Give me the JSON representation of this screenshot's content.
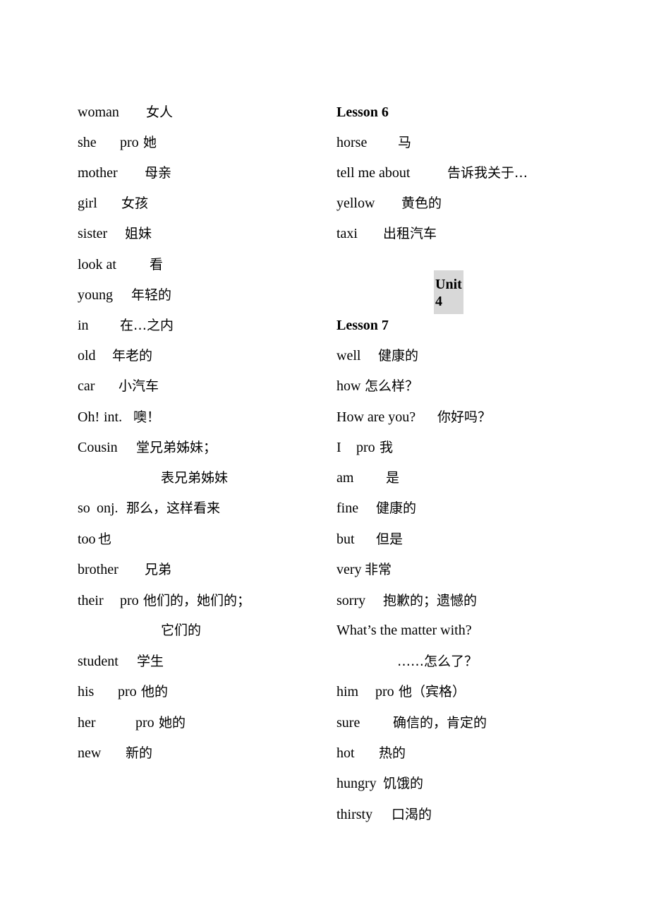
{
  "left_column": {
    "entries": [
      {
        "term": "woman",
        "meaning": "女人"
      },
      {
        "term": "she",
        "pos": "pro",
        "meaning": "她"
      },
      {
        "term": "mother",
        "meaning": "母亲"
      },
      {
        "term": "girl",
        "meaning": "女孩"
      },
      {
        "term": "sister",
        "meaning": "姐妹"
      },
      {
        "term": "look at",
        "meaning": "看"
      },
      {
        "term": "young",
        "meaning": "年轻的"
      },
      {
        "term": "in",
        "meaning": "在…之内"
      },
      {
        "term": "old",
        "meaning": "年老的"
      },
      {
        "term": "car",
        "meaning": "小汽车"
      },
      {
        "term": "Oh!",
        "pos": "int.",
        "meaning": "噢！"
      },
      {
        "term": "Cousin",
        "meaning": "堂兄弟姊妹；"
      },
      {
        "term": "",
        "meaning": "表兄弟姊妹"
      },
      {
        "term": "so",
        "pos": "onj.",
        "meaning": "那么，这样看来"
      },
      {
        "term": "too",
        "meaning": "也"
      },
      {
        "term": "brother",
        "meaning": "兄弟"
      },
      {
        "term": "their",
        "pos": "pro",
        "meaning": "他们的，她们的；"
      },
      {
        "term": "",
        "meaning": "它们的"
      },
      {
        "term": "student",
        "meaning": "学生"
      },
      {
        "term": "his",
        "pos": "pro",
        "meaning": "他的"
      },
      {
        "term": "her",
        "pos": "pro",
        "meaning": "她的"
      },
      {
        "term": "new",
        "meaning": "新的"
      }
    ]
  },
  "right_column": {
    "lesson6_heading": "Lesson 6",
    "lesson6_entries": [
      {
        "term": "horse",
        "meaning": "马"
      },
      {
        "term": "tell me about",
        "meaning": "告诉我关于…"
      },
      {
        "term": "yellow",
        "meaning": "黄色的"
      },
      {
        "term": "taxi",
        "meaning": "出租汽车"
      }
    ],
    "unit_heading": "Unit 4",
    "lesson7_heading": "Lesson 7",
    "lesson7_entries": [
      {
        "term": "well",
        "meaning": "健康的"
      },
      {
        "term": "how",
        "meaning": "怎么样？"
      },
      {
        "term": "How are you?",
        "meaning": "你好吗？"
      },
      {
        "term": "I",
        "pos": "pro",
        "meaning": "我"
      },
      {
        "term": "am",
        "meaning": "是"
      },
      {
        "term": "fine",
        "meaning": "健康的"
      },
      {
        "term": "but",
        "meaning": "但是"
      },
      {
        "term": "very",
        "meaning": "非常"
      },
      {
        "term": "sorry",
        "meaning": "抱歉的；遗憾的"
      },
      {
        "term": "What’s the matter with?",
        "meaning": ""
      },
      {
        "term": "",
        "meaning": "……怎么了？"
      },
      {
        "term": "him",
        "pos": "pro",
        "meaning": "他（宾格）"
      },
      {
        "term": "sure",
        "meaning": "确信的，肯定的"
      },
      {
        "term": "hot",
        "meaning": "热的"
      },
      {
        "term": "hungry",
        "meaning": "饥饿的"
      },
      {
        "term": "thirsty",
        "meaning": "口渴的"
      }
    ]
  }
}
